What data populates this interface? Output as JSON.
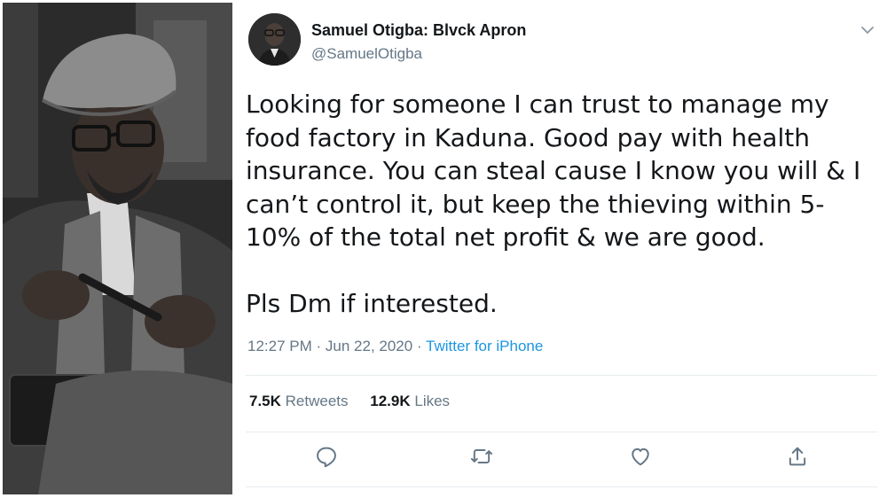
{
  "tweet": {
    "author_name": "Samuel Otigba: Blvck Apron",
    "author_handle": "@SamuelOtigba",
    "text_paragraph_1": "Looking for someone I can trust to manage my food factory in Kaduna. Good pay with health insurance. You can steal cause I know you will & I can’t control it, but keep the thieving within 5-10% of the total net profit & we are good.",
    "text_paragraph_2": "Pls Dm if interested.",
    "time": "12:27 PM",
    "date": "Jun 22, 2020",
    "separator": "·",
    "source": "Twitter for iPhone",
    "retweets_count": "7.5K",
    "retweets_label": "Retweets",
    "likes_count": "12.9K",
    "likes_label": "Likes"
  },
  "icons": {
    "menu": "chevron-down-icon",
    "reply": "reply-icon",
    "retweet": "retweet-icon",
    "like": "heart-icon",
    "share": "share-icon"
  },
  "colors": {
    "link": "#1b95e0",
    "secondary_text": "#657786",
    "primary_text": "#14171a",
    "divider": "#e6ecf0"
  }
}
